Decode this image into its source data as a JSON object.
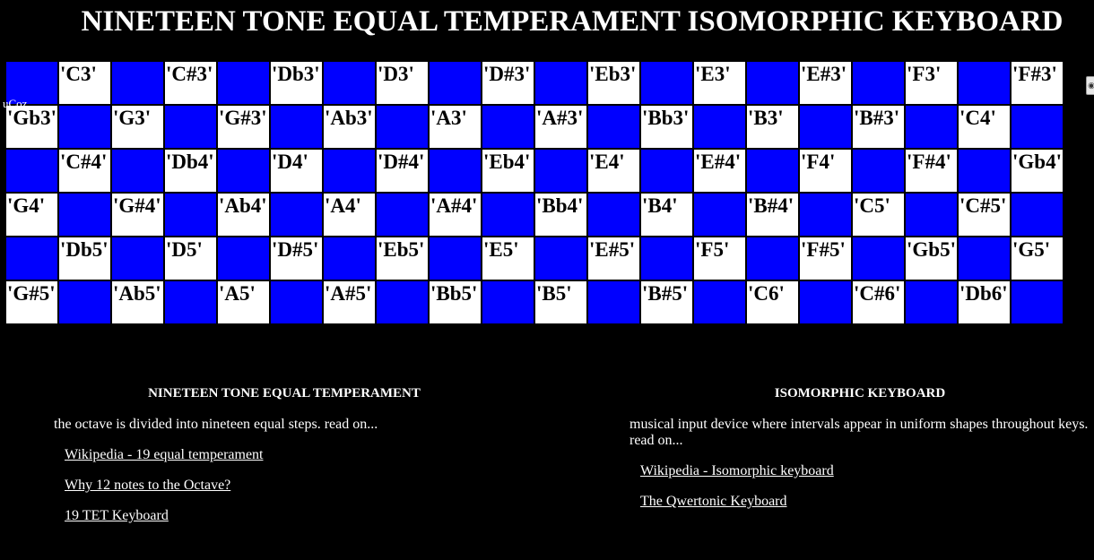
{
  "page_title": "NINETEEN TONE EQUAL TEMPERAMENT ISOMORPHIC KEYBOARD",
  "ucoz_label": "uCoz",
  "side_button_glyph": "◉",
  "keyboard": {
    "rows": [
      [
        {
          "t": "b",
          "l": ""
        },
        {
          "t": "w",
          "l": "'C3'"
        },
        {
          "t": "b",
          "l": ""
        },
        {
          "t": "w",
          "l": "'C#3'"
        },
        {
          "t": "b",
          "l": ""
        },
        {
          "t": "w",
          "l": "'Db3'"
        },
        {
          "t": "b",
          "l": ""
        },
        {
          "t": "w",
          "l": "'D3'"
        },
        {
          "t": "b",
          "l": ""
        },
        {
          "t": "w",
          "l": "'D#3'"
        },
        {
          "t": "b",
          "l": ""
        },
        {
          "t": "w",
          "l": "'Eb3'"
        },
        {
          "t": "b",
          "l": ""
        },
        {
          "t": "w",
          "l": "'E3'"
        },
        {
          "t": "b",
          "l": ""
        },
        {
          "t": "w",
          "l": "'E#3'"
        },
        {
          "t": "b",
          "l": ""
        },
        {
          "t": "w",
          "l": "'F3'"
        },
        {
          "t": "b",
          "l": ""
        },
        {
          "t": "w",
          "l": "'F#3'"
        }
      ],
      [
        {
          "t": "w",
          "l": "'Gb3'"
        },
        {
          "t": "b",
          "l": ""
        },
        {
          "t": "w",
          "l": "'G3'"
        },
        {
          "t": "b",
          "l": ""
        },
        {
          "t": "w",
          "l": "'G#3'"
        },
        {
          "t": "b",
          "l": ""
        },
        {
          "t": "w",
          "l": "'Ab3'"
        },
        {
          "t": "b",
          "l": ""
        },
        {
          "t": "w",
          "l": "'A3'"
        },
        {
          "t": "b",
          "l": ""
        },
        {
          "t": "w",
          "l": "'A#3'"
        },
        {
          "t": "b",
          "l": ""
        },
        {
          "t": "w",
          "l": "'Bb3'"
        },
        {
          "t": "b",
          "l": ""
        },
        {
          "t": "w",
          "l": "'B3'"
        },
        {
          "t": "b",
          "l": ""
        },
        {
          "t": "w",
          "l": "'B#3'"
        },
        {
          "t": "b",
          "l": ""
        },
        {
          "t": "w",
          "l": "'C4'"
        },
        {
          "t": "b",
          "l": ""
        }
      ],
      [
        {
          "t": "b",
          "l": ""
        },
        {
          "t": "w",
          "l": "'C#4'"
        },
        {
          "t": "b",
          "l": ""
        },
        {
          "t": "w",
          "l": "'Db4'"
        },
        {
          "t": "b",
          "l": ""
        },
        {
          "t": "w",
          "l": "'D4'"
        },
        {
          "t": "b",
          "l": ""
        },
        {
          "t": "w",
          "l": "'D#4'"
        },
        {
          "t": "b",
          "l": ""
        },
        {
          "t": "w",
          "l": "'Eb4'"
        },
        {
          "t": "b",
          "l": ""
        },
        {
          "t": "w",
          "l": "'E4'"
        },
        {
          "t": "b",
          "l": ""
        },
        {
          "t": "w",
          "l": "'E#4'"
        },
        {
          "t": "b",
          "l": ""
        },
        {
          "t": "w",
          "l": "'F4'"
        },
        {
          "t": "b",
          "l": ""
        },
        {
          "t": "w",
          "l": "'F#4'"
        },
        {
          "t": "b",
          "l": ""
        },
        {
          "t": "w",
          "l": "'Gb4'"
        }
      ],
      [
        {
          "t": "w",
          "l": "'G4'"
        },
        {
          "t": "b",
          "l": ""
        },
        {
          "t": "w",
          "l": "'G#4'"
        },
        {
          "t": "b",
          "l": ""
        },
        {
          "t": "w",
          "l": "'Ab4'"
        },
        {
          "t": "b",
          "l": ""
        },
        {
          "t": "w",
          "l": "'A4'"
        },
        {
          "t": "b",
          "l": ""
        },
        {
          "t": "w",
          "l": "'A#4'"
        },
        {
          "t": "b",
          "l": ""
        },
        {
          "t": "w",
          "l": "'Bb4'"
        },
        {
          "t": "b",
          "l": ""
        },
        {
          "t": "w",
          "l": "'B4'"
        },
        {
          "t": "b",
          "l": ""
        },
        {
          "t": "w",
          "l": "'B#4'"
        },
        {
          "t": "b",
          "l": ""
        },
        {
          "t": "w",
          "l": "'C5'"
        },
        {
          "t": "b",
          "l": ""
        },
        {
          "t": "w",
          "l": "'C#5'"
        },
        {
          "t": "b",
          "l": ""
        }
      ],
      [
        {
          "t": "b",
          "l": ""
        },
        {
          "t": "w",
          "l": "'Db5'"
        },
        {
          "t": "b",
          "l": ""
        },
        {
          "t": "w",
          "l": "'D5'"
        },
        {
          "t": "b",
          "l": ""
        },
        {
          "t": "w",
          "l": "'D#5'"
        },
        {
          "t": "b",
          "l": ""
        },
        {
          "t": "w",
          "l": "'Eb5'"
        },
        {
          "t": "b",
          "l": ""
        },
        {
          "t": "w",
          "l": "'E5'"
        },
        {
          "t": "b",
          "l": ""
        },
        {
          "t": "w",
          "l": "'E#5'"
        },
        {
          "t": "b",
          "l": ""
        },
        {
          "t": "w",
          "l": "'F5'"
        },
        {
          "t": "b",
          "l": ""
        },
        {
          "t": "w",
          "l": "'F#5'"
        },
        {
          "t": "b",
          "l": ""
        },
        {
          "t": "w",
          "l": "'Gb5'"
        },
        {
          "t": "b",
          "l": ""
        },
        {
          "t": "w",
          "l": "'G5'"
        }
      ],
      [
        {
          "t": "w",
          "l": "'G#5'"
        },
        {
          "t": "b",
          "l": ""
        },
        {
          "t": "w",
          "l": "'Ab5'"
        },
        {
          "t": "b",
          "l": ""
        },
        {
          "t": "w",
          "l": "'A5'"
        },
        {
          "t": "b",
          "l": ""
        },
        {
          "t": "w",
          "l": "'A#5'"
        },
        {
          "t": "b",
          "l": ""
        },
        {
          "t": "w",
          "l": "'Bb5'"
        },
        {
          "t": "b",
          "l": ""
        },
        {
          "t": "w",
          "l": "'B5'"
        },
        {
          "t": "b",
          "l": ""
        },
        {
          "t": "w",
          "l": "'B#5'"
        },
        {
          "t": "b",
          "l": ""
        },
        {
          "t": "w",
          "l": "'C6'"
        },
        {
          "t": "b",
          "l": ""
        },
        {
          "t": "w",
          "l": "'C#6'"
        },
        {
          "t": "b",
          "l": ""
        },
        {
          "t": "w",
          "l": "'Db6'"
        },
        {
          "t": "b",
          "l": ""
        }
      ]
    ]
  },
  "left_section": {
    "heading": "NINETEEN TONE EQUAL TEMPERAMENT",
    "description": "the octave is divided into nineteen equal steps. read on...",
    "links": [
      "Wikipedia - 19 equal temperament",
      "Why 12 notes to the Octave?",
      "19 TET Keyboard"
    ]
  },
  "right_section": {
    "heading": "ISOMORPHIC KEYBOARD",
    "description": "musical input device where intervals appear in uniform shapes throughout keys. read on...",
    "links": [
      "Wikipedia - Isomorphic keyboard",
      "The Qwertonic Keyboard"
    ]
  },
  "colors": {
    "background": "#000000",
    "blue_key": "#0000ff",
    "white_key": "#ffffff",
    "text": "#ffffff"
  }
}
